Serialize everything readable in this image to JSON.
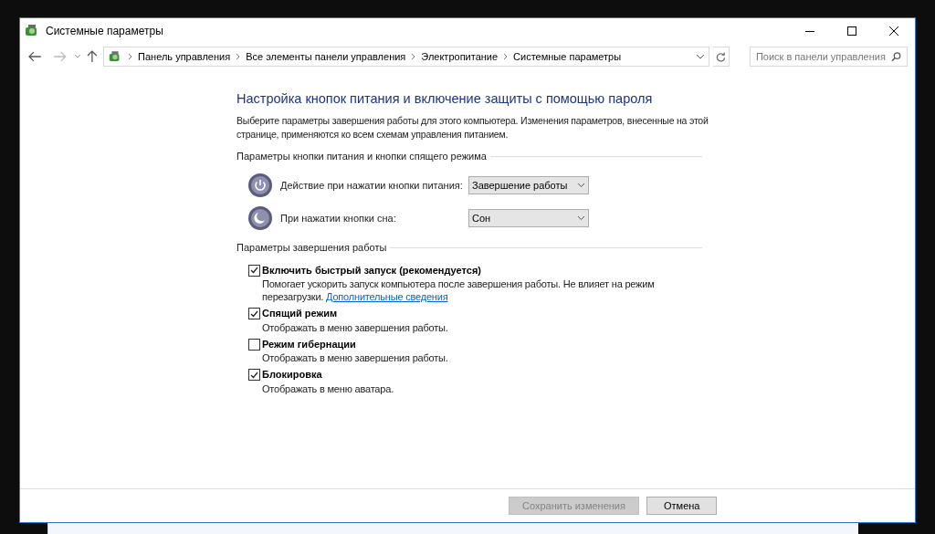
{
  "window": {
    "title": "Системные параметры"
  },
  "address_bar": {
    "breadcrumbs": [
      "Панель управления",
      "Все элементы панели управления",
      "Электропитание",
      "Системные параметры"
    ]
  },
  "search": {
    "placeholder": "Поиск в панели управления"
  },
  "heading": "Настройка кнопок питания и включение защиты с помощью пароля",
  "intro": "Выберите параметры завершения работы для этого компьютера. Изменения параметров, внесенные на этой странице, применяются ко всем схемам управления питанием.",
  "button_section": {
    "title": "Параметры кнопки питания и кнопки спящего режима",
    "rows": [
      {
        "kind": "power",
        "label": "Действие при нажатии кнопки питания:",
        "value": "Завершение работы"
      },
      {
        "kind": "sleep",
        "label": "При нажатии кнопки сна:",
        "value": "Сон"
      }
    ]
  },
  "shutdown_section": {
    "title": "Параметры завершения работы",
    "options": [
      {
        "label": "Включить быстрый запуск (рекомендуется)",
        "checked": true,
        "description": "Помогает ускорить запуск компьютера после завершения работы. Не влияет на режим перезагрузки.",
        "link": "Дополнительные сведения"
      },
      {
        "label": "Спящий режим",
        "checked": true,
        "description": "Отображать в меню завершения работы."
      },
      {
        "label": "Режим гибернации",
        "checked": false,
        "description": "Отображать в меню завершения работы."
      },
      {
        "label": "Блокировка",
        "checked": true,
        "description": "Отображать в меню аватара."
      }
    ]
  },
  "buttons": [
    {
      "label": "Сохранить изменения",
      "disabled": true
    },
    {
      "label": "Отмена",
      "disabled": false
    }
  ]
}
